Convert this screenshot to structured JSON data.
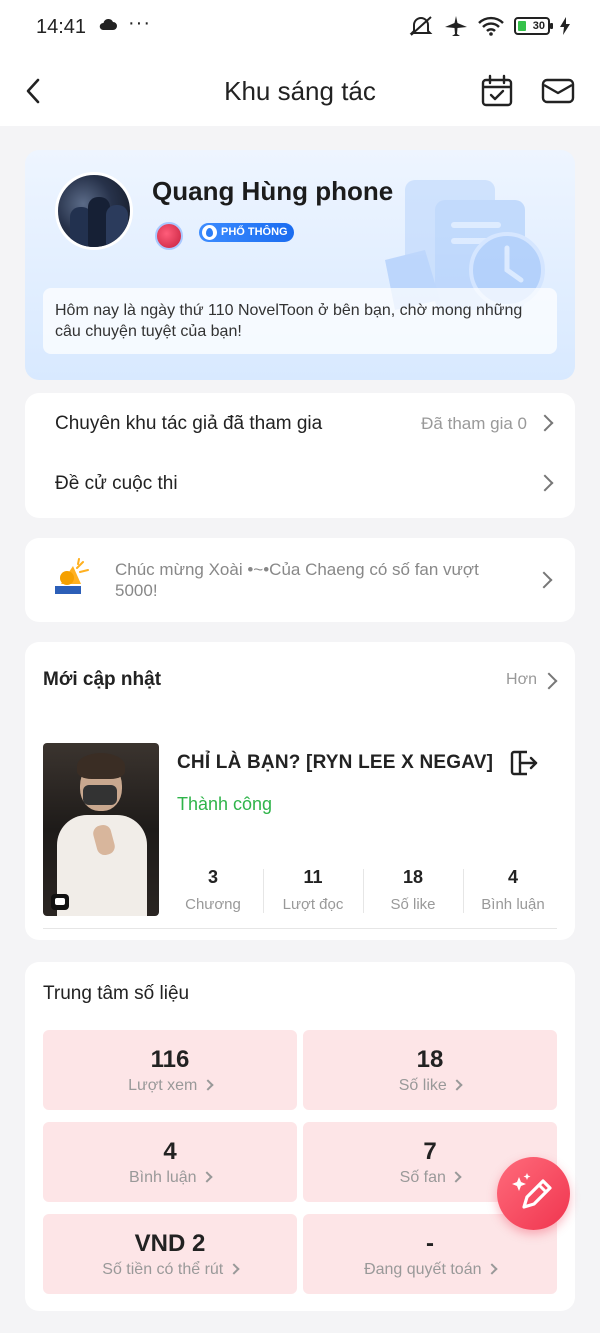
{
  "status_bar": {
    "time": "14:41",
    "battery": "30"
  },
  "header": {
    "title": "Khu sáng tác"
  },
  "profile": {
    "name": "Quang Hùng phone",
    "tier_badge": "PHỔ THÔNG",
    "welcome": "Hôm nay là ngày thứ 110 NovelToon ở bên bạn, chờ mong những câu chuyện tuyệt của bạn!"
  },
  "menu": {
    "items": [
      {
        "label": "Chuyên khu tác giả đã tham gia",
        "value": "Đã tham gia 0"
      },
      {
        "label": "Đề cử cuộc thi",
        "value": ""
      }
    ]
  },
  "notice": {
    "text": "Chúc mừng Xoài •~•Của Chaeng  có số fan vượt 5000!"
  },
  "recent": {
    "title": "Mới cập nhật",
    "more": "Hơn",
    "book": {
      "title": "CHỈ LÀ BẠN? [RYN LEE X NEGAV]",
      "status": "Thành công",
      "status_color": "#2fb44a",
      "stats": [
        {
          "value": "3",
          "label": "Chương"
        },
        {
          "value": "11",
          "label": "Lượt đọc"
        },
        {
          "value": "18",
          "label": "Số like"
        },
        {
          "value": "4",
          "label": "Bình luận"
        }
      ]
    }
  },
  "data_center": {
    "title": "Trung tâm số liệu",
    "tiles": [
      {
        "value": "116",
        "label": "Lượt xem"
      },
      {
        "value": "18",
        "label": "Số like"
      },
      {
        "value": "4",
        "label": "Bình luận"
      },
      {
        "value": "7",
        "label": "Số fan"
      },
      {
        "value": "VND 2",
        "label": "Số tiền có thể rút"
      },
      {
        "value": "-",
        "label": "Đang quyết toán"
      }
    ]
  },
  "colors": {
    "accent": "#f0354f",
    "tile_bg": "#fde5e7",
    "profile_bg": "#d8e9ff"
  },
  "icons": [
    "back-arrow-icon",
    "calendar-check-icon",
    "mail-icon",
    "megaphone-icon",
    "exit-icon",
    "pencil-sparkle-icon"
  ]
}
